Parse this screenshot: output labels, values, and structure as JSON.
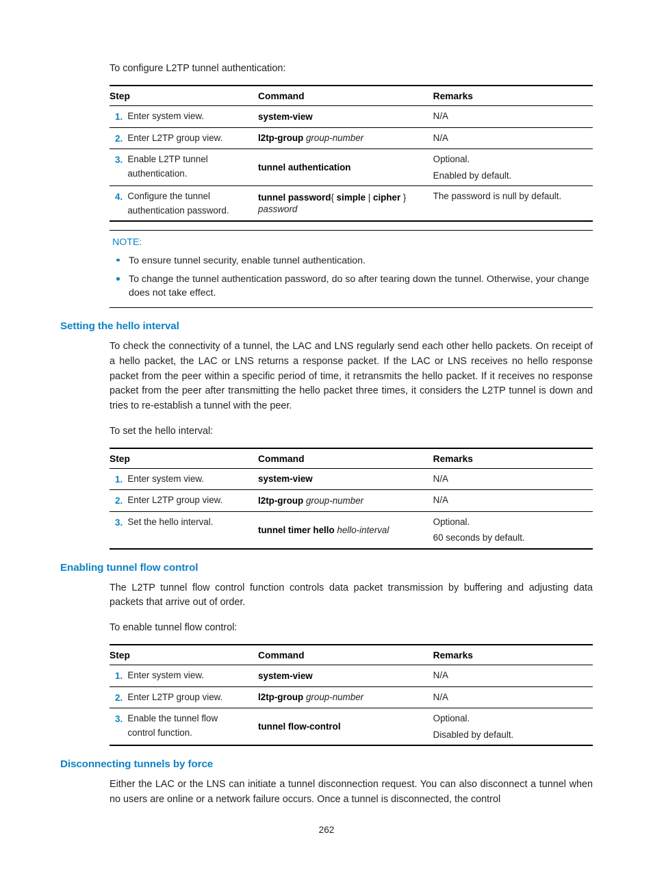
{
  "page": {
    "number": "262"
  },
  "intro": {
    "lead": "To configure L2TP tunnel authentication:"
  },
  "table_auth": {
    "headers": {
      "step": "Step",
      "command": "Command",
      "remarks": "Remarks"
    },
    "rows": [
      {
        "num": "1.",
        "desc": [
          "Enter system view."
        ],
        "cmd_bold": "system-view",
        "cmd_italic": "",
        "cmd_plain": "",
        "remarks": [
          "N/A"
        ]
      },
      {
        "num": "2.",
        "desc": [
          "Enter L2TP group view."
        ],
        "cmd_bold": "l2tp-group",
        "cmd_italic": "group-number",
        "cmd_plain": "",
        "remarks": [
          "N/A"
        ]
      },
      {
        "num": "3.",
        "desc": [
          "Enable L2TP tunnel",
          "authentication."
        ],
        "cmd_bold": "tunnel authentication",
        "cmd_italic": "",
        "cmd_plain": "",
        "remarks": [
          "Optional.",
          "Enabled by default."
        ]
      },
      {
        "num": "4.",
        "desc": [
          "Configure the tunnel",
          "authentication password."
        ],
        "cmd_bold": "tunnel password",
        "cmd_plain": "{ ",
        "cmd_bold2": "simple",
        "cmd_plain2": " | ",
        "cmd_bold3": "cipher",
        "cmd_plain3": " }",
        "cmd_italic": "password",
        "remarks": [
          "The password is null by default."
        ]
      }
    ]
  },
  "note": {
    "title": "NOTE:",
    "items": [
      "To ensure tunnel security, enable tunnel authentication.",
      "To change the tunnel authentication password, do so after tearing down the tunnel. Otherwise, your change does not take effect."
    ]
  },
  "section_hello": {
    "heading": "Setting the hello interval",
    "paragraph": "To check the connectivity of a tunnel, the LAC and LNS regularly send each other hello packets. On receipt of a hello packet, the LAC or LNS returns a response packet. If the LAC or LNS receives no hello response packet from the peer within a specific period of time, it retransmits the hello packet. If it receives no response packet from the peer after transmitting the hello packet three times, it considers the L2TP tunnel is down and tries to re-establish a tunnel with the peer.",
    "lead": "To set the hello interval:"
  },
  "table_hello": {
    "headers": {
      "step": "Step",
      "command": "Command",
      "remarks": "Remarks"
    },
    "rows": [
      {
        "num": "1.",
        "desc": [
          "Enter system view."
        ],
        "cmd_bold": "system-view",
        "cmd_italic": "",
        "remarks": [
          "N/A"
        ]
      },
      {
        "num": "2.",
        "desc": [
          "Enter L2TP group view."
        ],
        "cmd_bold": "l2tp-group",
        "cmd_italic": "group-number",
        "remarks": [
          "N/A"
        ]
      },
      {
        "num": "3.",
        "desc": [
          "Set the hello interval."
        ],
        "cmd_bold": "tunnel timer hello",
        "cmd_italic": "hello-interval",
        "remarks": [
          "Optional.",
          "60 seconds by default."
        ]
      }
    ]
  },
  "section_flow": {
    "heading": "Enabling tunnel flow control",
    "paragraph": "The L2TP tunnel flow control function controls data packet transmission by buffering and adjusting data packets that arrive out of order.",
    "lead": "To enable tunnel flow control:"
  },
  "table_flow": {
    "headers": {
      "step": "Step",
      "command": "Command",
      "remarks": "Remarks"
    },
    "rows": [
      {
        "num": "1.",
        "desc": [
          "Enter system view."
        ],
        "cmd_bold": "system-view",
        "cmd_italic": "",
        "remarks": [
          "N/A"
        ]
      },
      {
        "num": "2.",
        "desc": [
          "Enter L2TP group view."
        ],
        "cmd_bold": "l2tp-group",
        "cmd_italic": "group-number",
        "remarks": [
          "N/A"
        ]
      },
      {
        "num": "3.",
        "desc": [
          "Enable the tunnel flow",
          "control function."
        ],
        "cmd_bold": "tunnel flow-control",
        "cmd_italic": "",
        "remarks": [
          "Optional.",
          "Disabled by default."
        ]
      }
    ]
  },
  "section_disconnect": {
    "heading": "Disconnecting tunnels by force",
    "paragraph": "Either the LAC or the LNS can initiate a tunnel disconnection request. You can also disconnect a tunnel when no users are online or a network failure occurs. Once a tunnel is disconnected, the control"
  },
  "colors": {
    "accent": "#0e82c4",
    "text": "#231f20"
  }
}
